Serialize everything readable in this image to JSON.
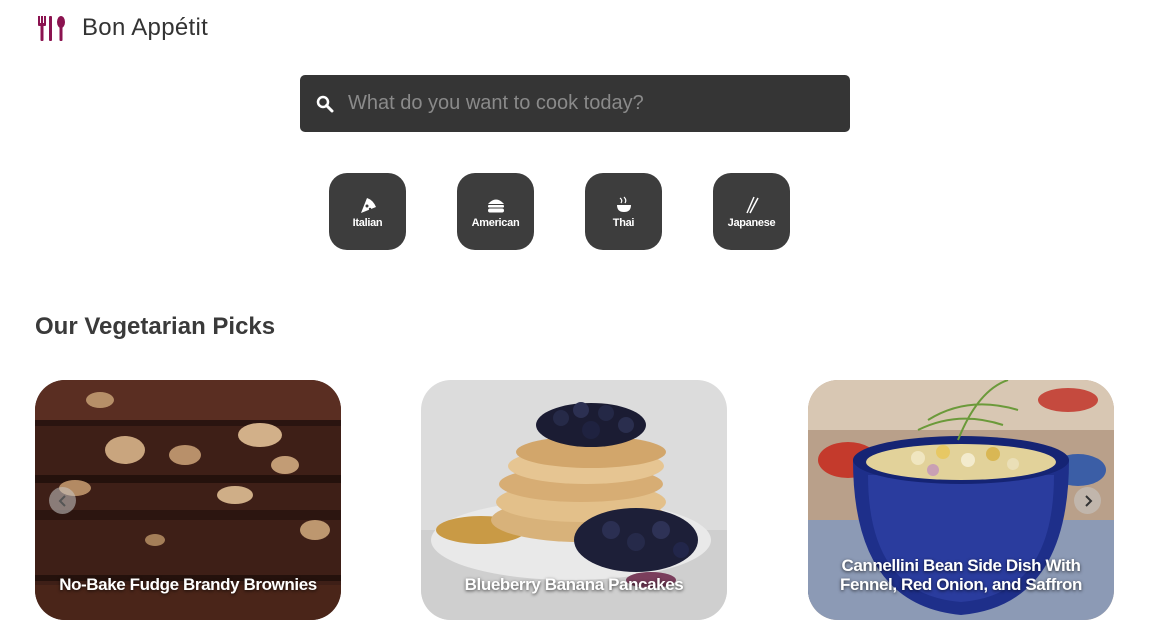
{
  "header": {
    "brand": "Bon Appétit",
    "logo_icon": "utensils-icon",
    "accent_color": "#8b1350"
  },
  "search": {
    "placeholder": "What do you want to cook today?",
    "value": "",
    "icon": "search-icon"
  },
  "categories": [
    {
      "label": "Italian",
      "icon": "pizza-icon"
    },
    {
      "label": "American",
      "icon": "burger-icon"
    },
    {
      "label": "Thai",
      "icon": "noodle-bowl-icon"
    },
    {
      "label": "Japanese",
      "icon": "chopsticks-icon"
    }
  ],
  "section": {
    "title": "Our Vegetarian Picks"
  },
  "recipes": [
    {
      "title": "No-Bake Fudge Brandy Brownies"
    },
    {
      "title": "Blueberry Banana Pancakes"
    },
    {
      "title": "Cannellini Bean Side Dish With Fennel, Red Onion, and Saffron"
    }
  ],
  "carousel": {
    "prev_icon": "chevron-left-icon",
    "next_icon": "chevron-right-icon"
  }
}
